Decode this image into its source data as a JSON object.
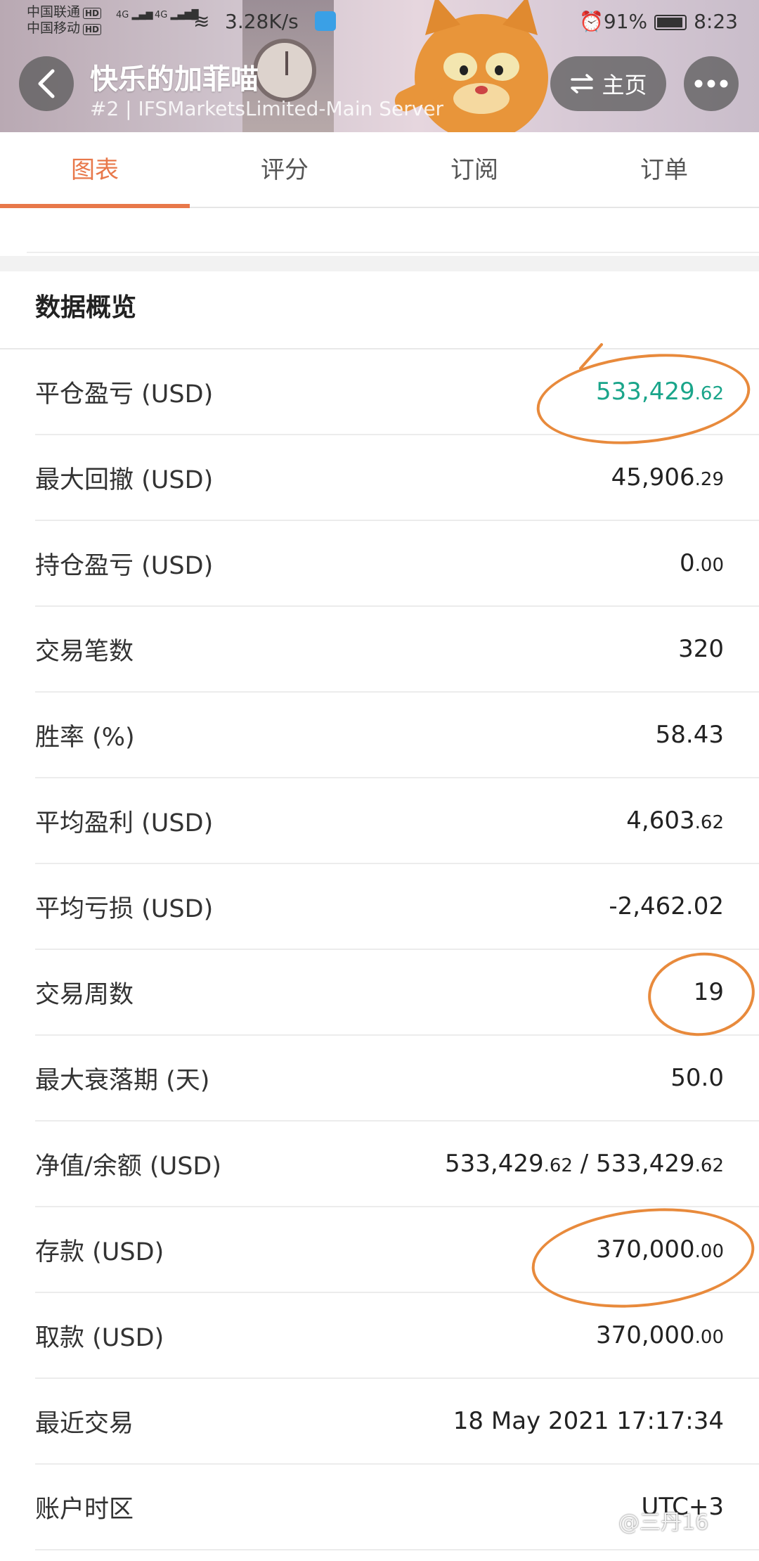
{
  "status_bar": {
    "carrier1": "中国联通",
    "carrier2": "中国移动",
    "hd": "HD",
    "net1": "4G",
    "net2": "4G",
    "speed": "3.28K/s",
    "battery": "91%",
    "time": "8:23"
  },
  "header": {
    "title": "快乐的加菲喵",
    "subtitle": "#2 | IFSMarketsLimited-Main Server",
    "home_label": "主页",
    "home_icon": "swap-icon",
    "back_icon": "chevron-left-icon",
    "more_icon": "more-dots-icon"
  },
  "tabs": [
    {
      "label": "图表",
      "active": true
    },
    {
      "label": "评分",
      "active": false
    },
    {
      "label": "订阅",
      "active": false
    },
    {
      "label": "订单",
      "active": false
    }
  ],
  "section": {
    "title": "数据概览"
  },
  "rows": [
    {
      "label": "平仓盈亏 (USD)",
      "int": "533,429",
      "dec": ".62",
      "color": "#1aa58a"
    },
    {
      "label": "最大回撤 (USD)",
      "int": "45,906",
      "dec": ".29"
    },
    {
      "label": "持仓盈亏 (USD)",
      "int": "0",
      "dec": ".00"
    },
    {
      "label": "交易笔数",
      "int": "320",
      "dec": ""
    },
    {
      "label": "胜率 (%)",
      "int": "58.43",
      "dec": ""
    },
    {
      "label": "平均盈利 (USD)",
      "int": "4,603",
      "dec": ".62"
    },
    {
      "label": "平均亏损 (USD)",
      "int": "-2,462.02",
      "dec": ""
    },
    {
      "label": "交易周数",
      "int": "19",
      "dec": ""
    },
    {
      "label": "最大衰落期 (天)",
      "int": "50.0",
      "dec": ""
    },
    {
      "label": "净值/余额 (USD)",
      "int": "533,429",
      "dec": ".62",
      "int2": " / 533,429",
      "dec2": ".62"
    },
    {
      "label": "存款 (USD)",
      "int": "370,000",
      "dec": ".00"
    },
    {
      "label": "取款 (USD)",
      "int": "370,000",
      "dec": ".00"
    },
    {
      "label": "最近交易",
      "int": "18 May 2021 17:17:34",
      "dec": ""
    },
    {
      "label": "账户时区",
      "int": "UTC+3",
      "dec": ""
    }
  ],
  "watermark": "@三丹16",
  "colors": {
    "accent": "#e8784a",
    "positive": "#1aa58a",
    "annotation": "#e88a3c"
  }
}
